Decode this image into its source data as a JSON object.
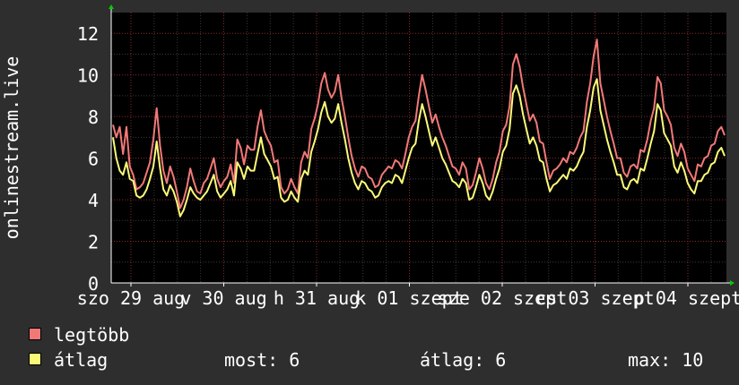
{
  "chart_data": {
    "type": "line",
    "ylabel": "onlinestream.live",
    "ylim": [
      0,
      13
    ],
    "yticks": [
      0,
      2,
      4,
      6,
      8,
      10,
      12
    ],
    "grid": true,
    "x_tick_labels": [
      "szo 29 aug",
      "v 30 aug",
      "h 31 aug",
      "k 01 szept",
      "sze 02 szept",
      "cs 03 szept",
      "p 04 szept"
    ],
    "colors": {
      "max": "#f27878",
      "avg": "#fafa78",
      "grid": "#8a2a2a",
      "background": "#000000"
    },
    "series": [
      {
        "name": "legtöbb",
        "values": [
          7.6,
          7.0,
          7.5,
          6.2,
          7.5,
          5.6,
          5.2,
          4.5,
          4.6,
          4.8,
          5.3,
          5.8,
          6.9,
          8.4,
          6.6,
          5.4,
          4.8,
          5.6,
          5.1,
          4.4,
          3.6,
          4.0,
          4.6,
          5.5,
          4.9,
          4.4,
          4.3,
          4.8,
          5.0,
          5.5,
          6.0,
          5.0,
          4.6,
          4.9,
          5.1,
          5.7,
          4.8,
          6.9,
          6.5,
          5.7,
          6.6,
          6.4,
          6.4,
          7.5,
          8.3,
          7.3,
          6.9,
          6.6,
          5.8,
          5.9,
          4.6,
          4.3,
          4.5,
          5.0,
          4.6,
          4.3,
          5.8,
          6.3,
          6.0,
          7.4,
          7.9,
          8.6,
          9.6,
          10.1,
          9.3,
          8.9,
          9.2,
          10.0,
          8.9,
          8.0,
          7.0,
          6.1,
          5.5,
          5.1,
          5.6,
          5.5,
          5.1,
          5.0,
          4.6,
          4.7,
          5.2,
          5.4,
          5.6,
          5.5,
          5.9,
          5.8,
          5.5,
          6.2,
          7.0,
          7.5,
          7.8,
          9.0,
          10.0,
          9.3,
          8.5,
          7.7,
          8.1,
          7.5,
          7.0,
          6.6,
          6.1,
          5.6,
          5.5,
          5.2,
          5.8,
          5.5,
          4.5,
          4.7,
          5.3,
          6.0,
          5.5,
          4.8,
          4.5,
          5.0,
          5.8,
          6.3,
          7.3,
          7.6,
          8.5,
          10.5,
          11.0,
          10.4,
          9.4,
          8.6,
          7.8,
          8.1,
          7.7,
          6.8,
          6.7,
          5.8,
          5.0,
          5.4,
          5.5,
          5.7,
          6.0,
          5.8,
          6.3,
          6.2,
          6.5,
          7.0,
          7.3,
          8.7,
          9.6,
          10.9,
          11.7,
          9.6,
          8.8,
          8.0,
          7.3,
          6.7,
          6.0,
          6.0,
          5.3,
          5.1,
          5.6,
          5.7,
          5.5,
          6.4,
          6.3,
          6.9,
          7.8,
          8.4,
          9.9,
          9.6,
          8.3,
          8.0,
          7.6,
          6.5,
          6.1,
          6.7,
          6.3,
          5.5,
          5.2,
          4.9,
          5.7,
          5.6,
          6.0,
          6.1,
          6.6,
          6.7,
          7.3,
          7.5,
          7.1
        ]
      },
      {
        "name": "átlag",
        "values": [
          7.0,
          6.0,
          5.4,
          5.2,
          5.8,
          5.0,
          4.9,
          4.2,
          4.1,
          4.2,
          4.5,
          5.0,
          5.6,
          6.8,
          5.5,
          4.5,
          4.2,
          4.7,
          4.4,
          3.9,
          3.2,
          3.5,
          4.0,
          4.6,
          4.3,
          4.1,
          4.0,
          4.2,
          4.4,
          4.8,
          5.2,
          4.4,
          4.1,
          4.3,
          4.5,
          4.9,
          4.2,
          5.8,
          5.5,
          5.0,
          5.6,
          5.4,
          5.4,
          6.2,
          7.0,
          6.2,
          5.9,
          5.6,
          5.0,
          5.1,
          4.1,
          3.9,
          4.0,
          4.4,
          4.1,
          3.9,
          5.0,
          5.4,
          5.2,
          6.3,
          6.8,
          7.4,
          8.2,
          8.7,
          8.0,
          7.7,
          7.9,
          8.6,
          7.7,
          6.9,
          6.0,
          5.3,
          4.8,
          4.5,
          4.9,
          4.8,
          4.5,
          4.4,
          4.1,
          4.2,
          4.6,
          4.8,
          4.9,
          4.8,
          5.2,
          5.1,
          4.8,
          5.4,
          6.0,
          6.5,
          6.7,
          7.8,
          8.6,
          8.0,
          7.3,
          6.6,
          7.0,
          6.5,
          6.0,
          5.7,
          5.3,
          4.9,
          4.8,
          4.6,
          5.0,
          4.8,
          4.0,
          4.1,
          4.6,
          5.2,
          4.8,
          4.2,
          4.0,
          4.4,
          5.0,
          5.5,
          6.3,
          6.6,
          7.4,
          9.1,
          9.5,
          9.0,
          8.1,
          7.4,
          6.7,
          7.0,
          6.6,
          5.9,
          5.8,
          5.0,
          4.4,
          4.7,
          4.8,
          5.0,
          5.2,
          5.0,
          5.5,
          5.4,
          5.6,
          6.0,
          6.3,
          7.5,
          8.3,
          9.4,
          9.8,
          8.3,
          7.6,
          6.9,
          6.3,
          5.8,
          5.2,
          5.2,
          4.6,
          4.5,
          4.9,
          5.0,
          4.8,
          5.5,
          5.4,
          6.0,
          6.7,
          7.3,
          8.6,
          8.3,
          7.2,
          6.9,
          6.6,
          5.6,
          5.3,
          5.8,
          5.4,
          4.8,
          4.5,
          4.3,
          4.9,
          4.9,
          5.2,
          5.3,
          5.7,
          5.8,
          6.3,
          6.5,
          6.1
        ]
      }
    ]
  },
  "legend": [
    {
      "label": "legtöbb",
      "color": "#f27878"
    },
    {
      "label": "átlag",
      "color": "#fafa78"
    }
  ],
  "stats": {
    "current": "most: 6",
    "average": "átlag: 6",
    "maximum": "max: 10"
  }
}
